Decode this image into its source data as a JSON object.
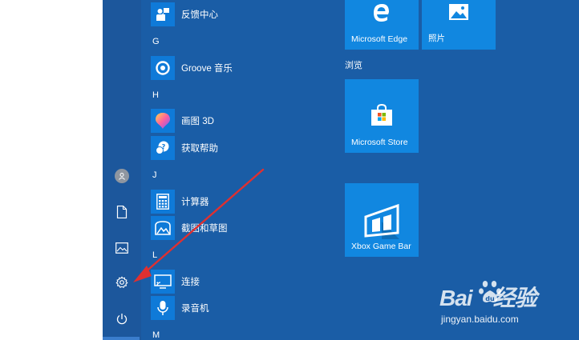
{
  "app_list": {
    "items": [
      {
        "label": "反馈中心"
      },
      {
        "label": "Groove 音乐"
      },
      {
        "label": "画图 3D"
      },
      {
        "label": "获取帮助"
      },
      {
        "label": "计算器"
      },
      {
        "label": "截图和草图"
      },
      {
        "label": "连接"
      },
      {
        "label": "录音机"
      }
    ],
    "letters": [
      "G",
      "H",
      "J",
      "L",
      "M"
    ]
  },
  "tiles": {
    "edge": {
      "label": "Microsoft Edge",
      "icon": "edge-icon"
    },
    "photos": {
      "label": "照片",
      "icon": "photos-icon"
    },
    "group_title": "浏览",
    "store": {
      "label": "Microsoft Store",
      "icon": "store-bag-icon"
    },
    "xbox": {
      "label": "Xbox Game Bar",
      "icon": "xbox-game-bar-icon"
    }
  },
  "rail": {
    "icons": [
      "user-avatar-icon",
      "document-icon",
      "pictures-icon",
      "settings-gear-icon",
      "power-icon"
    ]
  },
  "annotation": {
    "color": "#e03030",
    "points_to": "settings-gear-icon"
  },
  "watermark": {
    "logo_text": "Bai",
    "logo_text_2": "经验",
    "url": "jingyan.baidu.com"
  },
  "colors": {
    "start_bg": "#1a5da6",
    "tile": "#1187e0",
    "app_icon": "#0f7ad8"
  }
}
